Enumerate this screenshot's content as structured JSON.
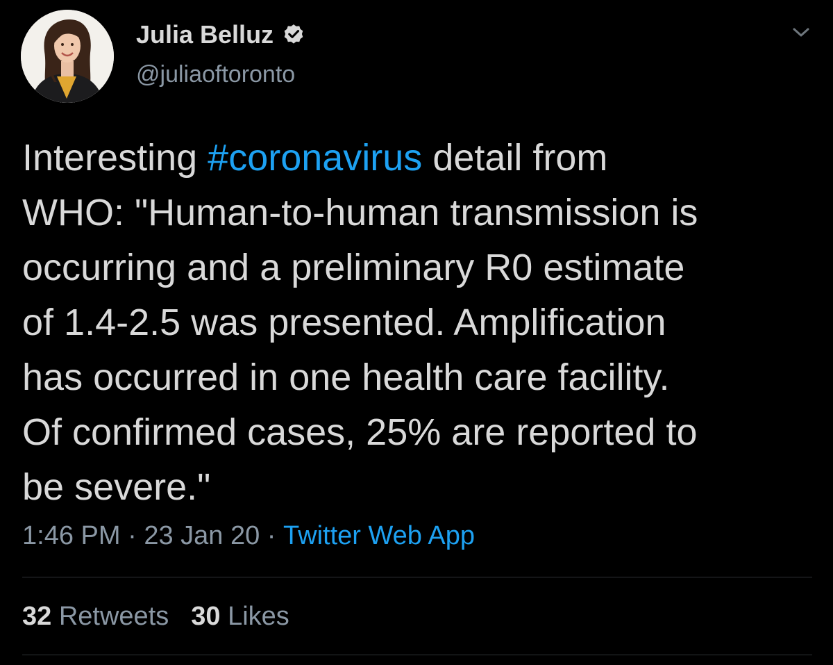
{
  "tweet": {
    "author": {
      "display_name": "Julia Belluz",
      "handle": "@juliaoftoronto",
      "verified": true,
      "avatar": "profile-photo"
    },
    "text_parts": [
      "Interesting ",
      "#coronavirus",
      " detail from\nWHO: \"Human-to-human transmission is\noccurring and a preliminary R0 estimate\nof 1.4-2.5 was presented. Amplification\nhas occurred in one health care facility.\nOf confirmed cases, 25% are reported to\nbe severe.\""
    ],
    "meta": {
      "time": "1:46 PM",
      "separator": " · ",
      "date": "23 Jan 20",
      "source": "Twitter Web App"
    },
    "stats": {
      "retweets_count": "32",
      "retweets_label": "Retweets",
      "likes_count": "30",
      "likes_label": "Likes"
    },
    "icons": {
      "verified": "verified-badge-icon",
      "menu": "chevron-down-icon"
    },
    "colors": {
      "background": "#000000",
      "text": "#d9d9d9",
      "secondary": "#8b98a5",
      "link": "#1da1f2"
    }
  }
}
